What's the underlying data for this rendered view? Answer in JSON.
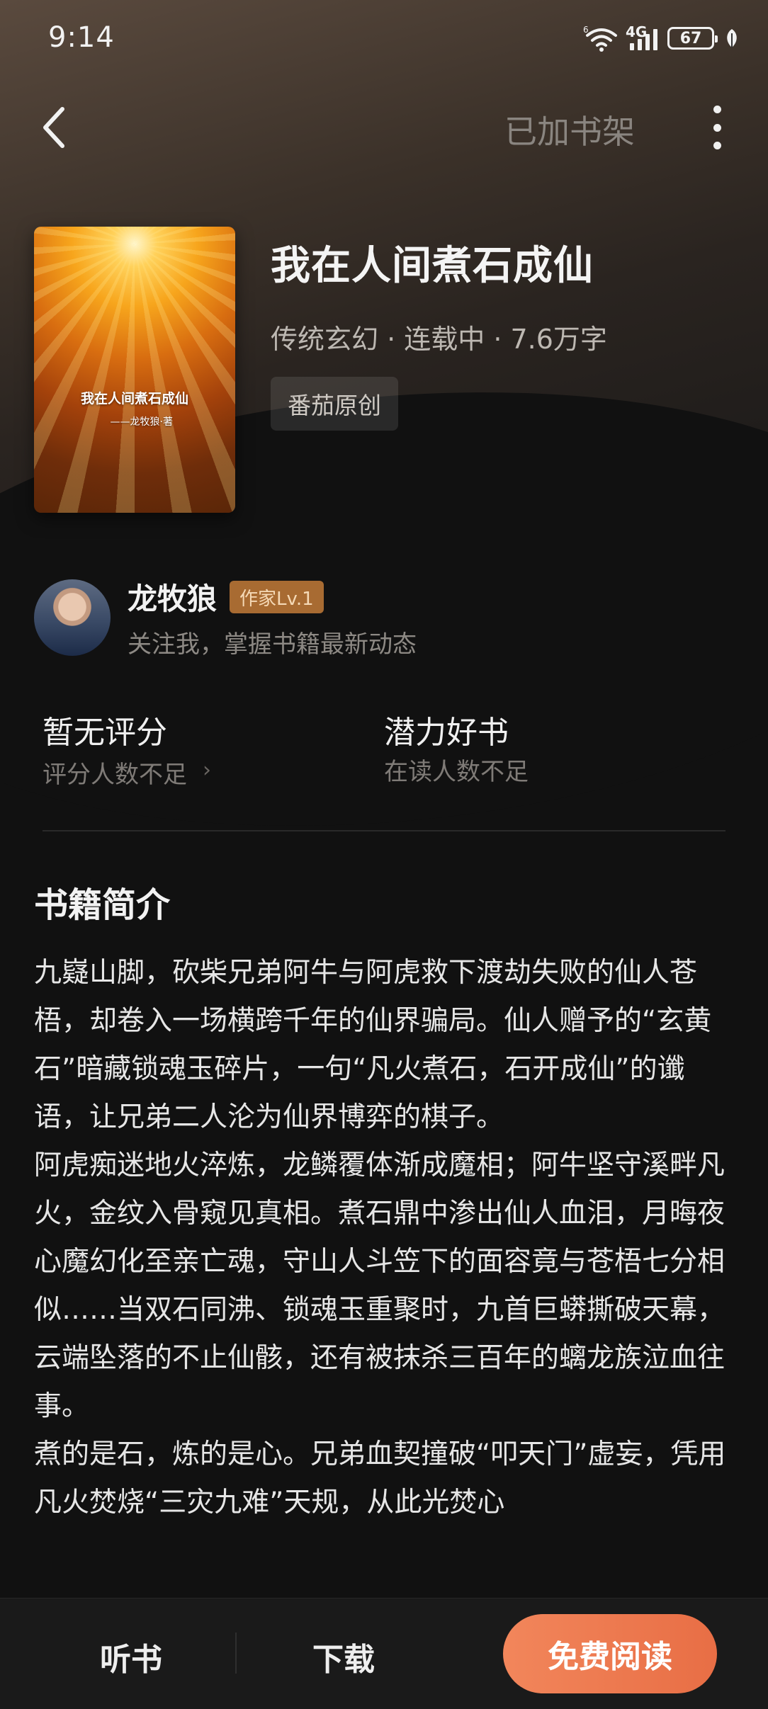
{
  "status_bar": {
    "time": "9:14",
    "network": "4G",
    "battery": "67"
  },
  "nav": {
    "back_icon": "chevron-left-icon",
    "shelf_label": "已加书架",
    "more_icon": "more-vertical-icon"
  },
  "book": {
    "cover_title": "我在人间煮石成仙",
    "cover_author": "——龙牧狼·著",
    "title": "我在人间煮石成仙",
    "meta": "传统玄幻 · 连载中 · 7.6万字",
    "tag": "番茄原创"
  },
  "author": {
    "name": "龙牧狼",
    "level": "作家Lv.1",
    "follow_text": "关注我，掌握书籍最新动态"
  },
  "ratings": {
    "score_title": "暂无评分",
    "score_sub": "评分人数不足",
    "chevron": "›",
    "potential_title": "潜力好书",
    "potential_sub": "在读人数不足"
  },
  "intro": {
    "heading": "书籍简介",
    "paragraphs": [
      "九嶷山脚，砍柴兄弟阿牛与阿虎救下渡劫失败的仙人苍梧，却卷入一场横跨千年的仙界骗局。仙人赠予的“玄黄石”暗藏锁魂玉碎片，一句“凡火煮石，石开成仙”的谶语，让兄弟二人沦为仙界博弈的棋子。",
      "阿虎痴迷地火淬炼，龙鳞覆体渐成魔相；阿牛坚守溪畔凡火，金纹入骨窥见真相。煮石鼎中渗出仙人血泪，月晦夜心魔幻化至亲亡魂，守山人斗笠下的面容竟与苍梧七分相似……当双石同沸、锁魂玉重聚时，九首巨蟒撕破天幕，云端坠落的不止仙骸，还有被抹杀三百年的螭龙族泣血往事。",
      "煮的是石，炼的是心。兄弟血契撞破“叩天门”虚妄，凭用凡火焚烧“三灾九难”天规，从此光焚心"
    ]
  },
  "bottom_bar": {
    "listen_label": "听书",
    "download_label": "下载",
    "read_label": "免费阅读"
  }
}
